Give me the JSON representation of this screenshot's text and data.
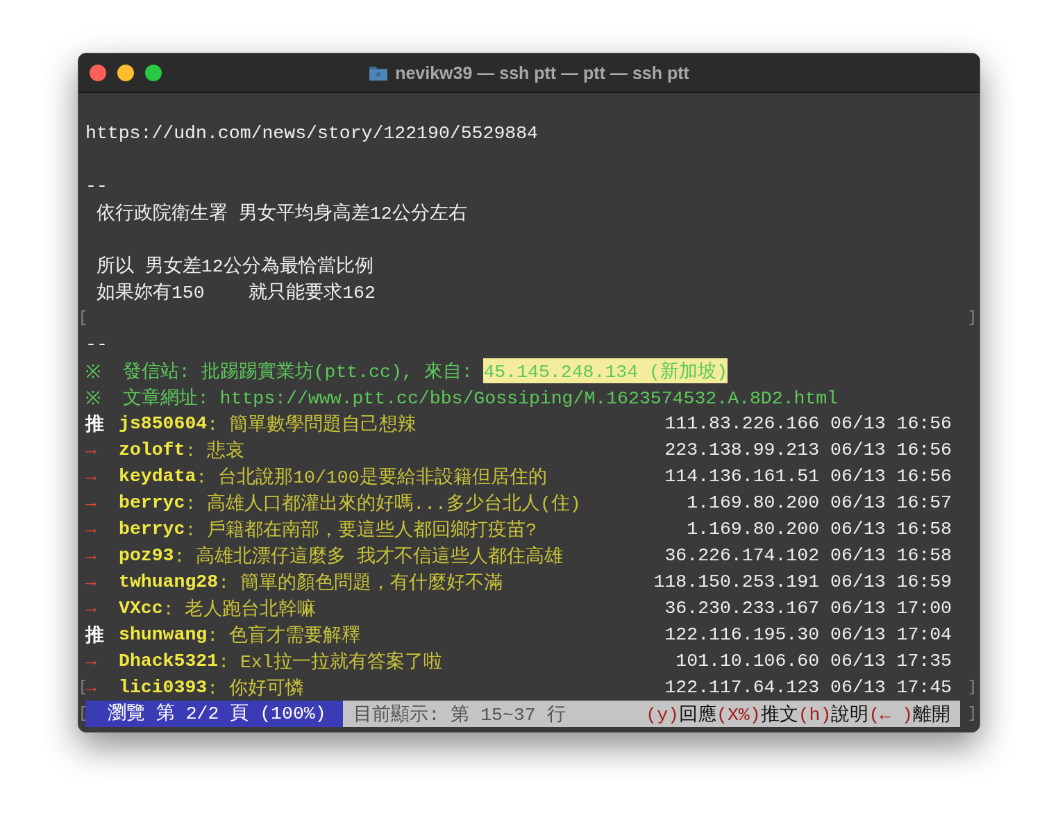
{
  "window": {
    "title": "nevikw39 — ssh ptt — ptt — ssh ptt"
  },
  "body": [
    {
      "kind": "blank"
    },
    {
      "kind": "text",
      "text": "https://udn.com/news/story/122190/5529884"
    },
    {
      "kind": "blank"
    },
    {
      "kind": "text",
      "text": "--"
    },
    {
      "kind": "text",
      "text": " 依行政院衛生署 男女平均身高差12公分左右"
    },
    {
      "kind": "blank"
    },
    {
      "kind": "text",
      "text": " 所以 男女差12公分為最恰當比例"
    },
    {
      "kind": "text",
      "text": " 如果妳有150    就只能要求162"
    },
    {
      "kind": "edge",
      "left": "[",
      "right": "]"
    },
    {
      "kind": "text",
      "text": "--"
    }
  ],
  "signature": [
    {
      "mark": "※",
      "text": "  發信站: 批踢踢實業坊(ptt.cc), 來自: ",
      "highlight": "45.145.248.134 (新加坡)"
    },
    {
      "mark": "※",
      "text": "  文章網址: https://www.ptt.cc/bbs/Gossiping/M.1623574532.A.8D2.html"
    }
  ],
  "pushes": [
    {
      "kind": "push",
      "tag": "推",
      "user": "js850604",
      "content": ": 簡單數學問題自己想辣",
      "ip": "111.83.226.166",
      "time": "06/13 16:56"
    },
    {
      "kind": "arrow",
      "tag": "→",
      "user": "zoloft",
      "content": ": 悲哀",
      "ip": "223.138.99.213",
      "time": "06/13 16:56"
    },
    {
      "kind": "arrow",
      "tag": "→",
      "user": "keydata",
      "content": ": 台北說那10/100是要給非設籍但居住的",
      "ip": "114.136.161.51",
      "time": "06/13 16:56"
    },
    {
      "kind": "arrow",
      "tag": "→",
      "user": "berryc",
      "content": ": 高雄人口都灌出來的好嗎...多少台北人(住)",
      "ip": "1.169.80.200",
      "time": "06/13 16:57"
    },
    {
      "kind": "arrow",
      "tag": "→",
      "user": "berryc",
      "content": ": 戶籍都在南部，要這些人都回鄉打疫苗?",
      "ip": "1.169.80.200",
      "time": "06/13 16:58"
    },
    {
      "kind": "arrow",
      "tag": "→",
      "user": "poz93",
      "content": ": 高雄北漂仔這麼多 我才不信這些人都住高雄",
      "ip": "36.226.174.102",
      "time": "06/13 16:58"
    },
    {
      "kind": "arrow",
      "tag": "→",
      "user": "twhuang28",
      "content": ": 簡單的顏色問題，有什麼好不滿",
      "ip": "118.150.253.191",
      "time": "06/13 16:59"
    },
    {
      "kind": "arrow",
      "tag": "→",
      "user": "VXcc",
      "content": ": 老人跑台北幹嘛",
      "ip": "36.230.233.167",
      "time": "06/13 17:00"
    },
    {
      "kind": "push",
      "tag": "推",
      "user": "shunwang",
      "content": ": 色盲才需要解釋",
      "ip": "122.116.195.30",
      "time": "06/13 17:04"
    },
    {
      "kind": "arrow",
      "tag": "→",
      "user": "Dhack5321",
      "content": ": Exl拉一拉就有答案了啦",
      "ip": "101.10.106.60",
      "time": "06/13 17:35"
    },
    {
      "kind": "arrow",
      "tag": "→",
      "user": "lici0393",
      "content": ": 你好可憐",
      "ip": "122.117.64.123",
      "time": "06/13 17:45",
      "left": "[",
      "right": "]"
    }
  ],
  "status_bar": {
    "left": "[",
    "right": "]",
    "page": " 瀏覽 第 2/2 頁 (100%) ",
    "info": " 目前顯示: 第 15~37 行 ",
    "keys": [
      {
        "key": "(y)",
        "label": "回應"
      },
      {
        "key": "(X%)",
        "label": "推文"
      },
      {
        "key": "(h)",
        "label": "說明"
      },
      {
        "key": "(← )",
        "label": "離開"
      }
    ]
  }
}
